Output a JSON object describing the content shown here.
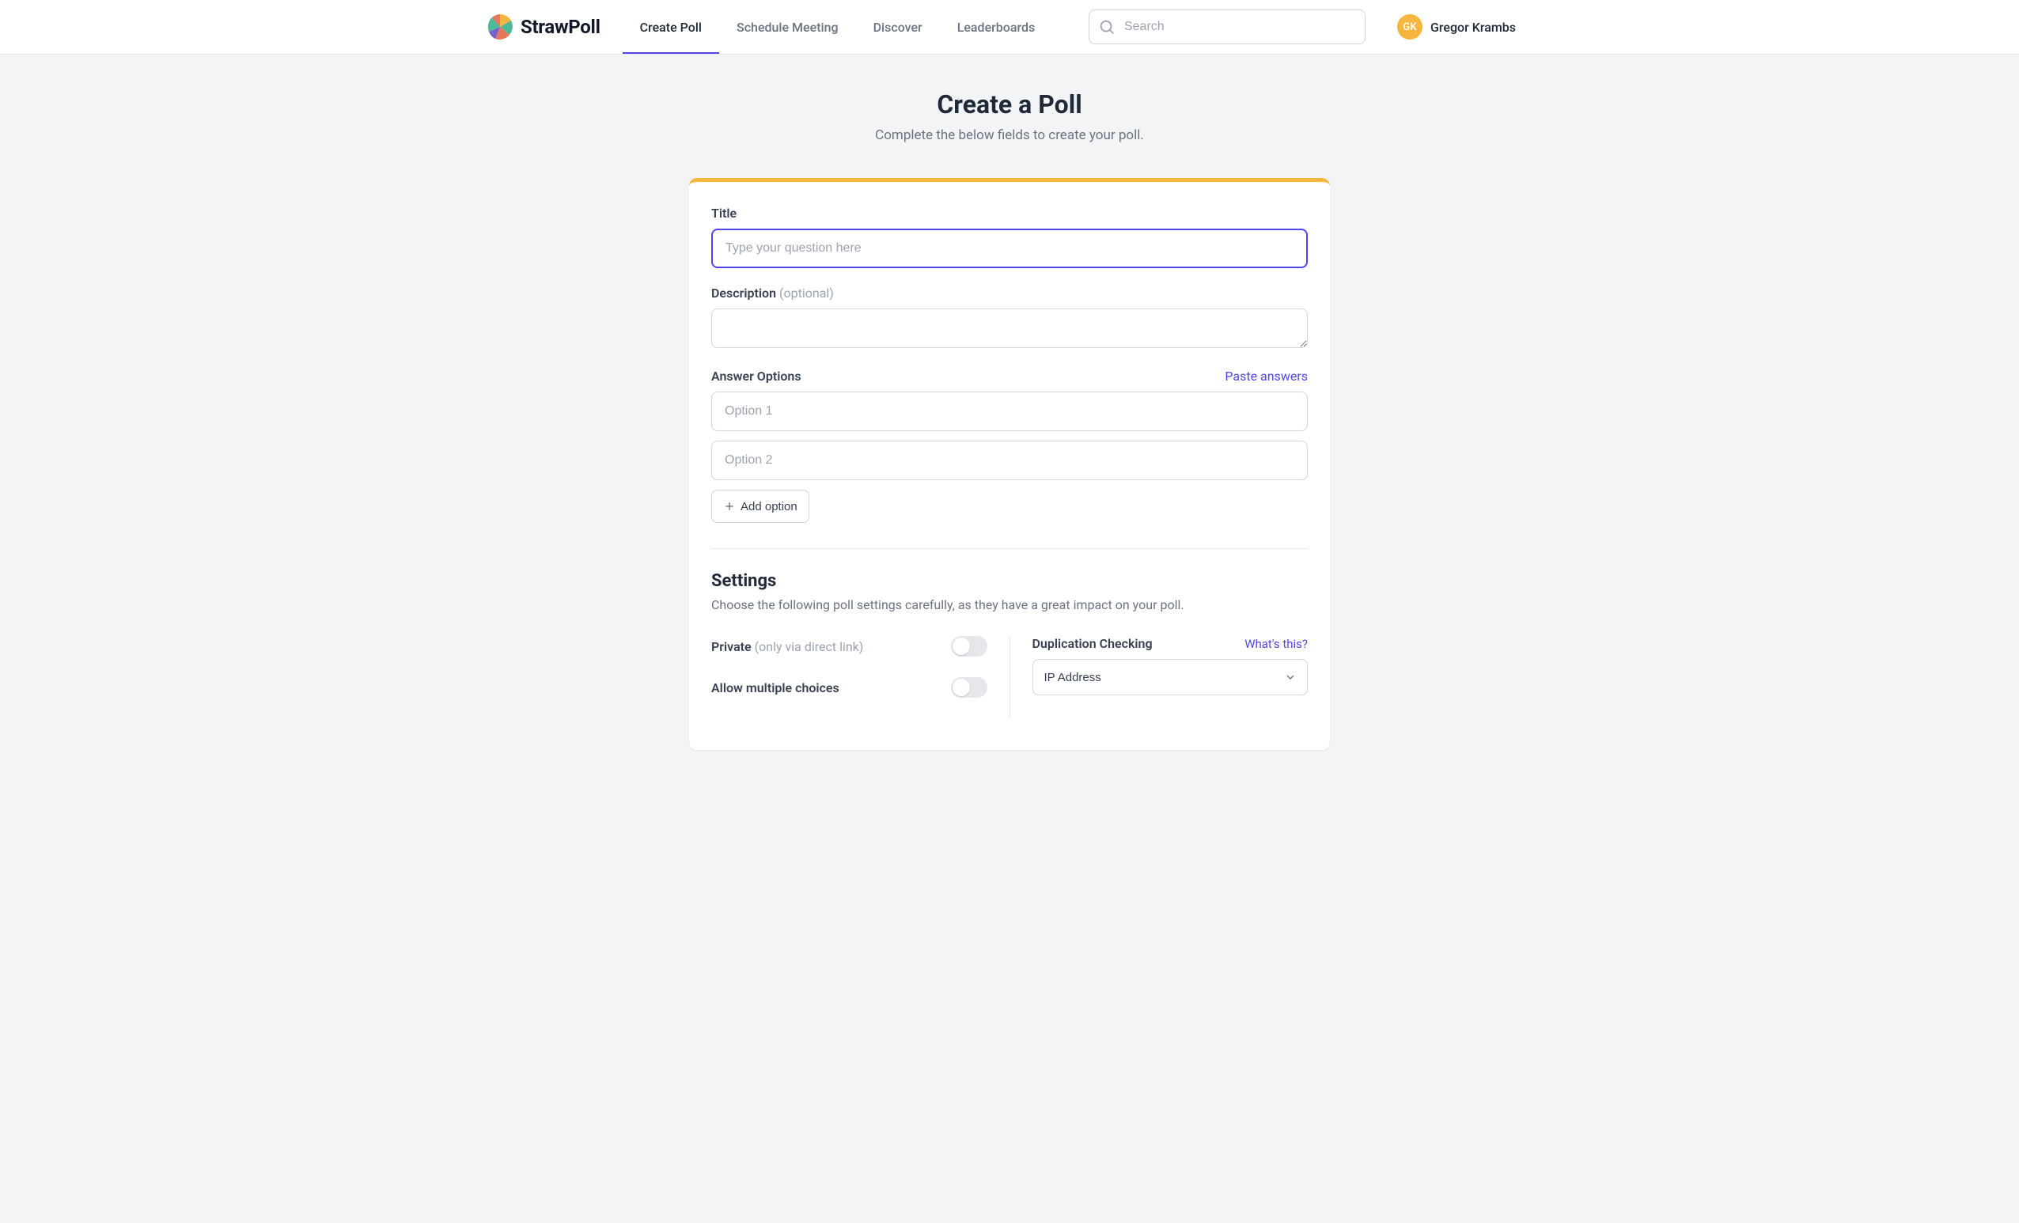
{
  "brand": "StrawPoll",
  "nav": {
    "items": [
      {
        "label": "Create Poll",
        "active": true
      },
      {
        "label": "Schedule Meeting",
        "active": false
      },
      {
        "label": "Discover",
        "active": false
      },
      {
        "label": "Leaderboards",
        "active": false
      }
    ]
  },
  "search": {
    "placeholder": "Search"
  },
  "user": {
    "initials": "GK",
    "name": "Gregor Krambs"
  },
  "page": {
    "title": "Create a Poll",
    "subtitle": "Complete the below fields to create your poll."
  },
  "form": {
    "title_label": "Title",
    "title_placeholder": "Type your question here",
    "description_label": "Description",
    "description_optional": "(optional)",
    "options_label": "Answer Options",
    "paste_answers": "Paste answers",
    "option_placeholders": [
      "Option 1",
      "Option 2"
    ],
    "add_option": "Add option"
  },
  "settings": {
    "title": "Settings",
    "desc": "Choose the following poll settings carefully, as they have a great impact on your poll.",
    "private_label": "Private",
    "private_hint": "(only via direct link)",
    "multiple_label": "Allow multiple choices",
    "dup_label": "Duplication Checking",
    "whats_this": "What's this?",
    "dup_value": "IP Address"
  },
  "colors": {
    "accent": "#4f46e5",
    "accent_bar": "#f5b53f",
    "avatar_bg": "#f5b53f"
  }
}
